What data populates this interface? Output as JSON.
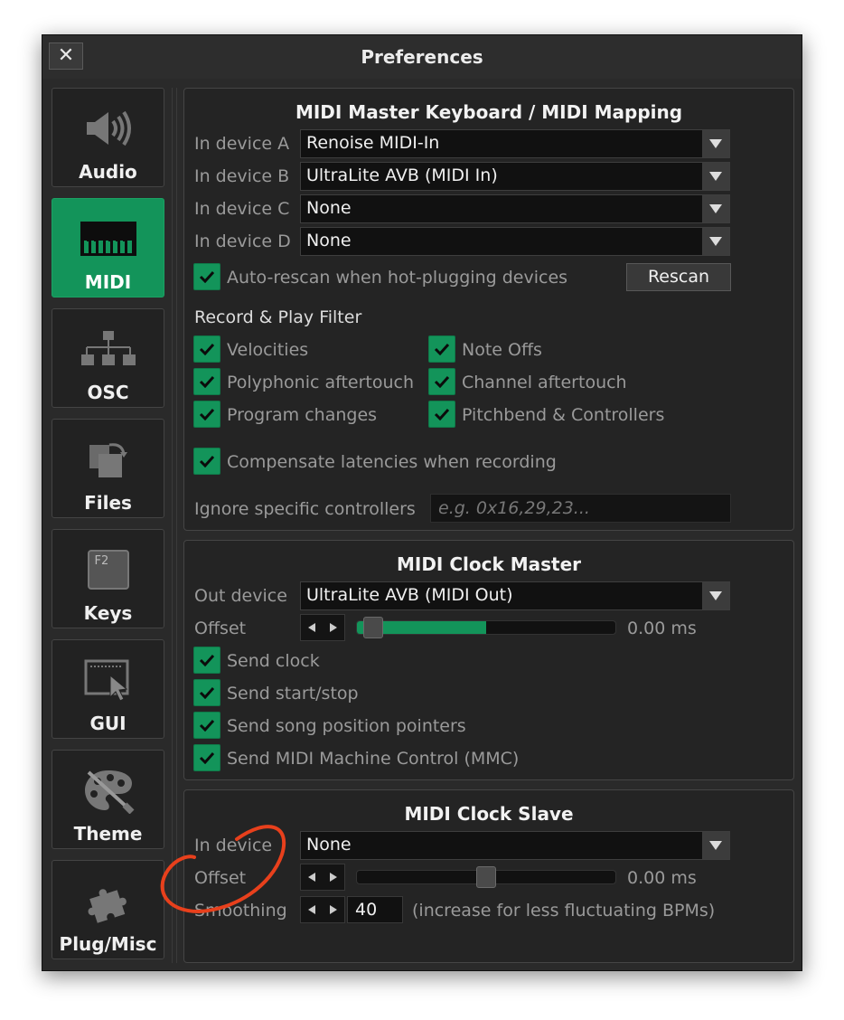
{
  "window": {
    "title": "Preferences",
    "close_symbol": "✕"
  },
  "sidebar": {
    "items": [
      {
        "label": "Audio",
        "icon": "speaker-icon"
      },
      {
        "label": "MIDI",
        "icon": "piano-keys-icon",
        "active": true
      },
      {
        "label": "OSC",
        "icon": "network-icon"
      },
      {
        "label": "Files",
        "icon": "files-icon"
      },
      {
        "label": "Keys",
        "icon": "f2-key-icon",
        "key_text": "F2"
      },
      {
        "label": "GUI",
        "icon": "window-cursor-icon"
      },
      {
        "label": "Theme",
        "icon": "palette-icon"
      },
      {
        "label": "Plug/Misc",
        "icon": "puzzle-icon"
      }
    ]
  },
  "mapping": {
    "title": "MIDI Master Keyboard / MIDI Mapping",
    "devices": [
      {
        "label": "In device A",
        "value": "Renoise MIDI-In"
      },
      {
        "label": "In device B",
        "value": "UltraLite AVB (MIDI In)"
      },
      {
        "label": "In device C",
        "value": "None"
      },
      {
        "label": "In device D",
        "value": "None"
      }
    ],
    "auto_rescan": {
      "label": "Auto-rescan when hot-plugging devices",
      "checked": true
    },
    "rescan_label": "Rescan",
    "filter_heading": "Record & Play Filter",
    "filters": [
      {
        "label": "Velocities",
        "checked": true
      },
      {
        "label": "Note Offs",
        "checked": true
      },
      {
        "label": "Polyphonic aftertouch",
        "checked": true
      },
      {
        "label": "Channel aftertouch",
        "checked": true
      },
      {
        "label": "Program changes",
        "checked": true
      },
      {
        "label": "Pitchbend & Controllers",
        "checked": true
      }
    ],
    "compensate": {
      "label": "Compensate latencies when recording",
      "checked": true
    },
    "ignore_label": "Ignore specific controllers",
    "ignore_placeholder": "e.g. 0x16,29,23..."
  },
  "clock_master": {
    "title": "MIDI Clock Master",
    "out_label": "Out device",
    "out_value": "UltraLite AVB (MIDI Out)",
    "offset_label": "Offset",
    "offset_value": "0.00 ms",
    "offset_fill_fraction": 0.5,
    "options": [
      {
        "label": "Send clock",
        "checked": true
      },
      {
        "label": "Send start/stop",
        "checked": true
      },
      {
        "label": "Send song position pointers",
        "checked": true
      },
      {
        "label": "Send MIDI Machine Control (MMC)",
        "checked": true
      }
    ]
  },
  "clock_slave": {
    "title": "MIDI Clock Slave",
    "in_label": "In device",
    "in_value": "None",
    "offset_label": "Offset",
    "offset_value": "0.00 ms",
    "offset_position_fraction": 0.5,
    "smoothing_label": "Smoothing",
    "smoothing_value": "40",
    "smoothing_hint": "(increase for less fluctuating BPMs)"
  },
  "colors": {
    "accent_green": "#13945a",
    "annotation_red": "#e8401c"
  }
}
